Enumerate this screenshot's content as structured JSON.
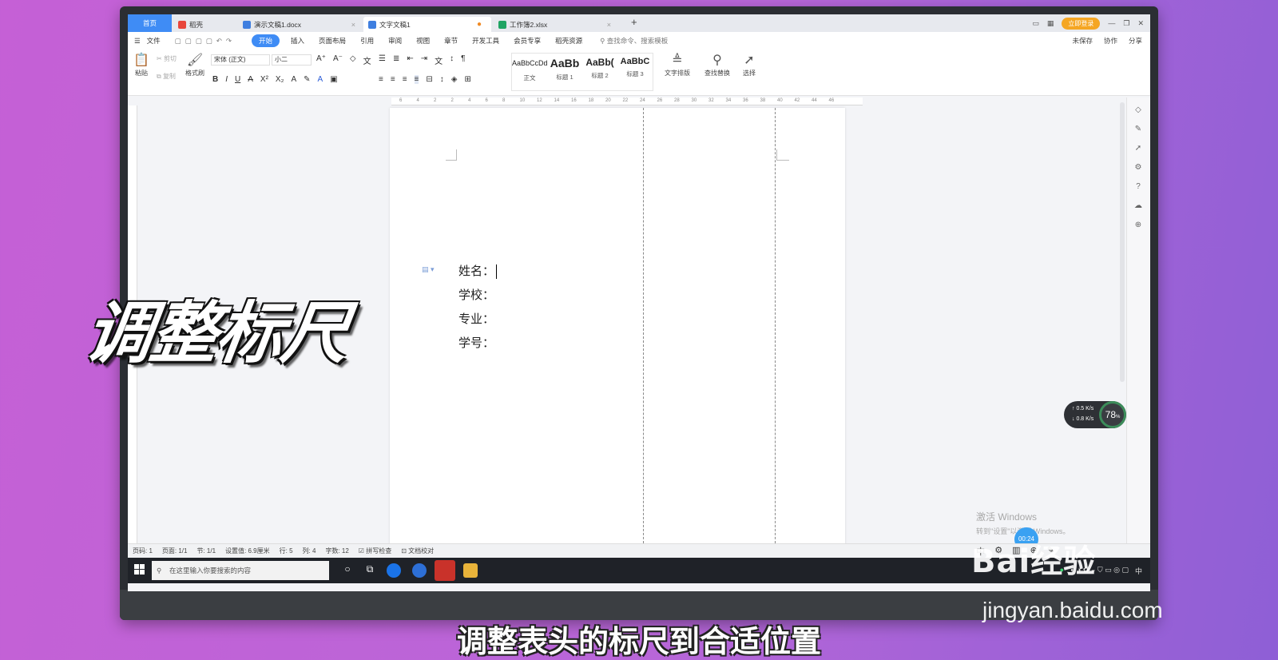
{
  "tabs": {
    "home": "首页",
    "daoke": "稻壳",
    "doc1": "演示文稿1.docx",
    "active": "文字文稿1",
    "xlsx": "工作簿2.xlsx"
  },
  "titlebar": {
    "login": "立即登录"
  },
  "menu": {
    "file": "文件",
    "items": [
      "开始",
      "插入",
      "页面布局",
      "引用",
      "审阅",
      "视图",
      "章节",
      "开发工具",
      "会员专享",
      "稻壳资源"
    ],
    "search": "查找命令、搜索模板",
    "unsaved": "未保存",
    "collab": "协作",
    "share": "分享"
  },
  "toolbar": {
    "paste": "粘贴",
    "cut": "剪切",
    "copy": "复制",
    "format_painter": "格式刷",
    "font_name": "宋体 (正文)",
    "font_size": "小二",
    "styles": [
      {
        "preview": "AaBbCcDd",
        "name": "正文"
      },
      {
        "preview": "AaBb",
        "name": "标题 1"
      },
      {
        "preview": "AaBb(",
        "name": "标题 2"
      },
      {
        "preview": "AaBbC",
        "name": "标题 3"
      }
    ],
    "text_layout": "文字排版",
    "find_replace": "查找替换",
    "select": "选择"
  },
  "ruler_ticks": [
    "6",
    "4",
    "2",
    "2",
    "4",
    "6",
    "8",
    "10",
    "12",
    "14",
    "16",
    "18",
    "20",
    "22",
    "24",
    "26",
    "28",
    "30",
    "32",
    "34",
    "36",
    "38",
    "40",
    "42",
    "44",
    "46"
  ],
  "document": {
    "fields": [
      "姓名：",
      "学校：",
      "专业：",
      "学号："
    ]
  },
  "status": {
    "page_num": "页码: 1",
    "pages": "页面: 1/1",
    "section": "节: 1/1",
    "setting": "设置值: 6.9厘米",
    "row": "行: 5",
    "col": "列: 4",
    "words": "字数: 12",
    "spell": "拼写检查",
    "proof": "文档校对",
    "ime": "中"
  },
  "taskbar": {
    "search_placeholder": "在这里输入你要搜索的内容",
    "tray_ime": "中"
  },
  "watermark": {
    "title": "激活 Windows",
    "sub": "转到\"设置\"以激活 Windows。"
  },
  "net": {
    "up": "0.5",
    "down": "0.8",
    "percent": "78",
    "timer": "00:24"
  },
  "overlay": {
    "title": "调整标尺",
    "subtitle": "调整表头的标尺到合适位置"
  },
  "brand": {
    "logo": "Bai经验",
    "url": "jingyan.baidu.com"
  }
}
